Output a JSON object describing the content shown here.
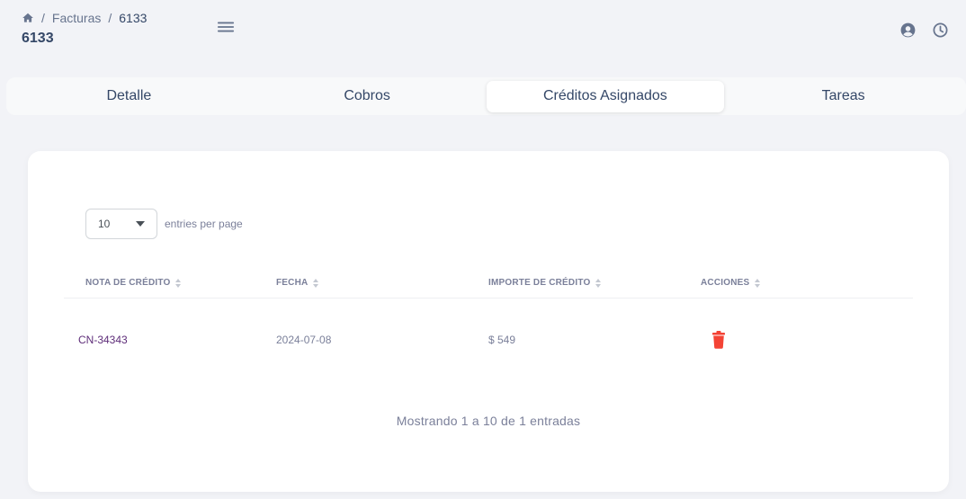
{
  "breadcrumb": {
    "home_icon": "home-icon",
    "items": [
      "Facturas",
      "6133"
    ],
    "separator": "/"
  },
  "page": {
    "title": "6133"
  },
  "header_icons": [
    "user-circle-icon",
    "clock-icon"
  ],
  "tabs": [
    {
      "label": "Detalle",
      "active": false
    },
    {
      "label": "Cobros",
      "active": false
    },
    {
      "label": "Créditos Asignados",
      "active": true
    },
    {
      "label": "Tareas",
      "active": false
    }
  ],
  "table": {
    "entries_per_page": "10",
    "entries_label": "entries per page",
    "columns": [
      "NOTA DE CRÉDITO",
      "FECHA",
      "IMPORTE DE CRÉDITO",
      "ACCIONES"
    ],
    "rows": [
      {
        "nota": "CN-34343",
        "fecha": "2024-07-08",
        "importe": "$ 549",
        "action_icon": "trash-icon"
      }
    ],
    "footer": "Mostrando 1 a 10 de 1 entradas"
  },
  "colors": {
    "accent": "#5e2d79",
    "danger": "#f44335",
    "text": "#344767",
    "muted": "#7b809a"
  }
}
